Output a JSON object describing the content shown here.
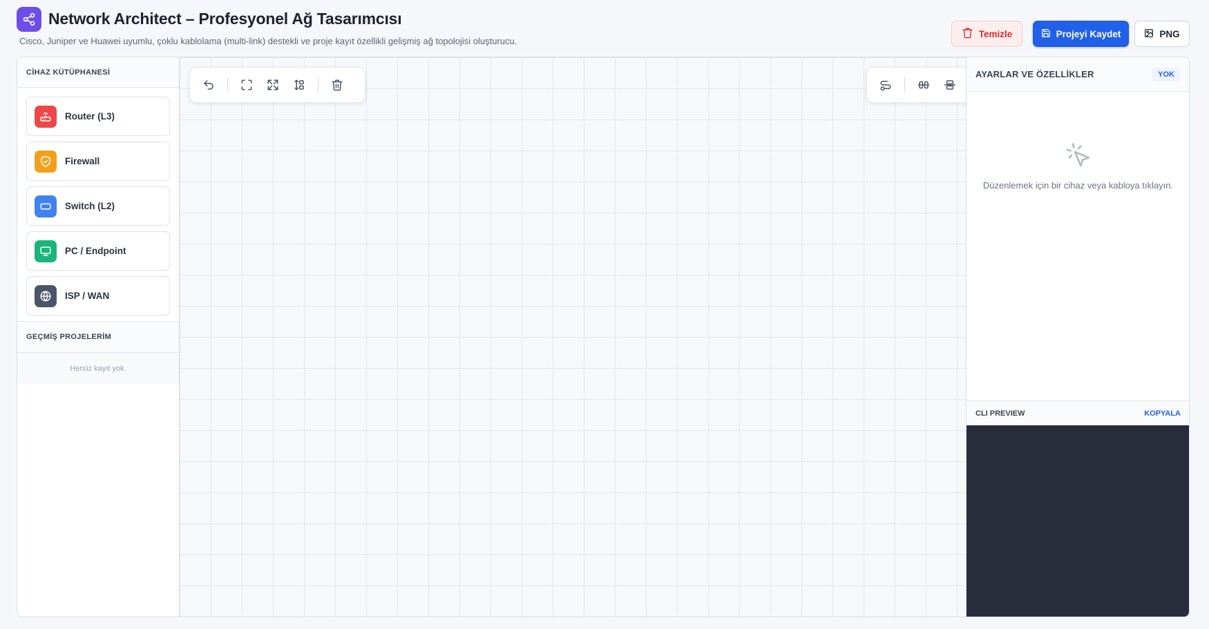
{
  "header": {
    "title": "Network Architect – Profesyonel Ağ Tasarımcısı",
    "subtitle": "Cisco, Juniper ve Huawei uyumlu, çoklu kablolama (multi-link) destekli ve proje kayıt özellikli gelişmiş ağ topolojisi oluşturucu.",
    "logo_icon": "share-nodes-icon",
    "buttons": {
      "clear_label": "Temizle",
      "save_label": "Projeyi Kaydet",
      "png_label": "PNG"
    }
  },
  "sidebar": {
    "library_title": "CİHAZ KÜTÜPHANESİ",
    "devices": [
      {
        "label": "Router (L3)",
        "icon": "router-icon",
        "color": "#ee4747"
      },
      {
        "label": "Firewall",
        "icon": "shield-icon",
        "color": "#f2a01b"
      },
      {
        "label": "Switch (L2)",
        "icon": "switch-icon",
        "color": "#3f82f1"
      },
      {
        "label": "PC / Endpoint",
        "icon": "monitor-icon",
        "color": "#19b57c"
      },
      {
        "label": "ISP / WAN",
        "icon": "globe-icon",
        "color": "#4b5568"
      }
    ],
    "projects_title": "GEÇMİŞ PROJELERİM",
    "projects_empty": "Henüz kayıt yok."
  },
  "canvas": {
    "toolbar_left": [
      "undo-icon",
      "fit-screen-icon",
      "expand-icon",
      "auto-layout-icon",
      "delete-icon"
    ],
    "toolbar_right": [
      "route-icon",
      "align-vertical-icon",
      "align-horizontal-icon"
    ]
  },
  "settings": {
    "title": "AYARLAR VE ÖZELLİKLER",
    "badge": "YOK",
    "empty_text": "Düzenlemek için bir cihaz veya kabloya tıklayın."
  },
  "cli": {
    "title": "CLI PREVIEW",
    "copy_label": "KOPYALA",
    "content": ""
  },
  "colors": {
    "accent": "#2160e8",
    "logo": "#6d4ee8",
    "danger": "#d62f2f",
    "cli_background": "#292d3b"
  }
}
